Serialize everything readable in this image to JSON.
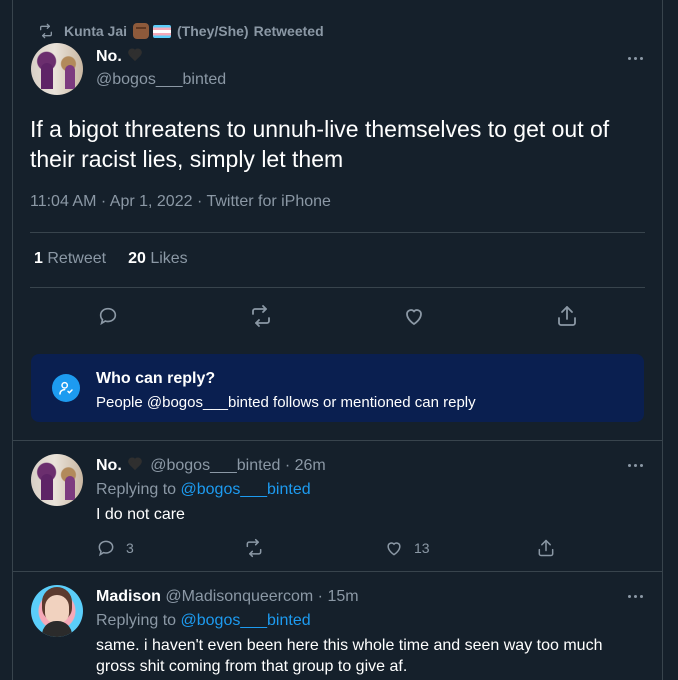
{
  "retweet_header": {
    "user": "Kunta Jai",
    "pronouns": "(They/She)",
    "action": "Retweeted"
  },
  "main_tweet": {
    "name": "No.",
    "handle": "@bogos___binted",
    "text": "If a bigot threatens to unnuh-live themselves to get out of their racist lies, simply let them",
    "time": "11:04 AM",
    "date": "Apr 1, 2022",
    "source": "Twitter for iPhone",
    "retweets_count": "1",
    "retweets_label": "Retweet",
    "likes_count": "20",
    "likes_label": "Likes"
  },
  "who_can_reply": {
    "title": "Who can reply?",
    "subtitle": "People @bogos___binted follows or mentioned can reply"
  },
  "replies": [
    {
      "name": "No.",
      "handle": "@bogos___binted",
      "age": "26m",
      "replying_prefix": "Replying to",
      "replying_to": "@bogos___binted",
      "text": "I do not care",
      "reply_count": "3",
      "retweet_count": "",
      "like_count": "13"
    },
    {
      "name": "Madison",
      "handle": "@Madisonqueercom",
      "age": "15m",
      "replying_prefix": "Replying to",
      "replying_to": "@bogos___binted",
      "text_line1": "same. i haven't even been here this whole time and seen way too much",
      "text_line2": "gross shit coming from that group to give af."
    }
  ],
  "colors": {
    "background": "#15202b",
    "muted": "#8b98a5",
    "link": "#1d9bf0",
    "notice_bg": "#0a1f50",
    "divider": "#38444d"
  },
  "icons": [
    "retweet-icon",
    "more-icon",
    "reply-icon",
    "like-icon",
    "share-icon",
    "mention-icon"
  ]
}
